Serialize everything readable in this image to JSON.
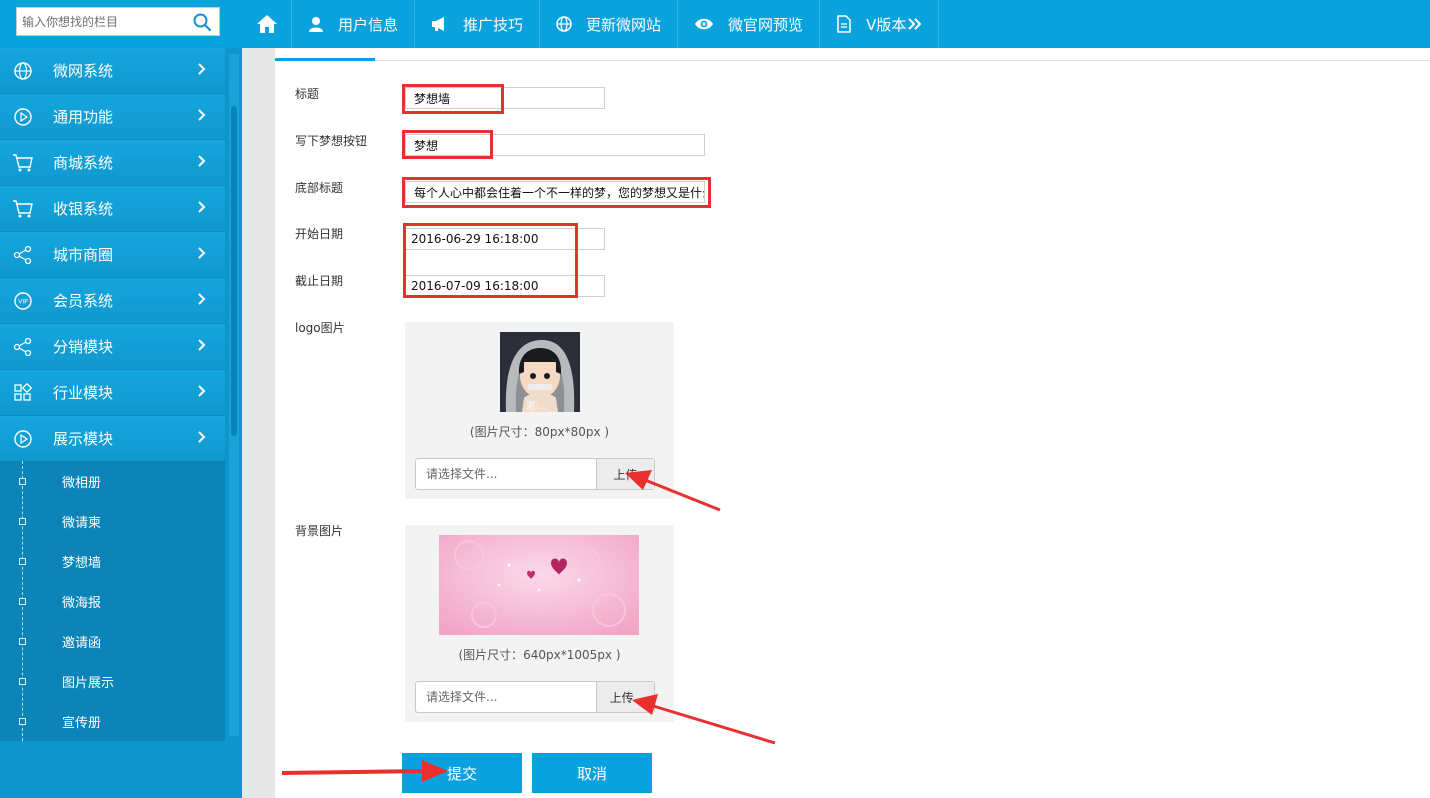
{
  "search": {
    "placeholder": "输入你想找的栏目"
  },
  "topnav": {
    "home_icon": "home-icon",
    "items": [
      {
        "label": "用户信息",
        "icon": "user-icon"
      },
      {
        "label": "推广技巧",
        "icon": "megaphone-icon"
      },
      {
        "label": "更新微网站",
        "icon": "globe-icon"
      },
      {
        "label": "微官网预览",
        "icon": "eye-icon"
      },
      {
        "label": "V版本",
        "icon": "document-icon"
      }
    ]
  },
  "sidebar": {
    "items": [
      {
        "label": "微网系统",
        "icon": "globe-icon"
      },
      {
        "label": "通用功能",
        "icon": "play-icon"
      },
      {
        "label": "商城系统",
        "icon": "cart-icon"
      },
      {
        "label": "收银系统",
        "icon": "cart-icon"
      },
      {
        "label": "城市商圈",
        "icon": "share-icon"
      },
      {
        "label": "会员系统",
        "icon": "vip-icon"
      },
      {
        "label": "分销模块",
        "icon": "share-icon"
      },
      {
        "label": "行业模块",
        "icon": "grid-icon"
      },
      {
        "label": "展示模块",
        "icon": "play-icon"
      }
    ],
    "submenu": [
      {
        "label": "微相册"
      },
      {
        "label": "微请柬"
      },
      {
        "label": "梦想墙"
      },
      {
        "label": "微海报"
      },
      {
        "label": "邀请函"
      },
      {
        "label": "图片展示"
      },
      {
        "label": "宣传册"
      }
    ]
  },
  "form": {
    "title_label": "标题",
    "title_value": "梦想墙",
    "button_label": "写下梦想按钮",
    "button_value": "梦想",
    "footer_label": "底部标题",
    "footer_value": "每个人心中都会住着一个不一样的梦，您的梦想又是什么",
    "start_label": "开始日期",
    "start_value": "2016-06-29 16:18:00",
    "end_label": "截止日期",
    "end_value": "2016-07-09 16:18:00",
    "logo_label": "logo图片",
    "logo_hint": "(图片尺寸：80px*80px )",
    "logo_file_placeholder": "请选择文件...",
    "logo_upload": "上传",
    "bg_label": "背景图片",
    "bg_hint": "(图片尺寸：640px*1005px )",
    "bg_file_placeholder": "请选择文件...",
    "bg_upload": "上传..",
    "submit": "提交",
    "cancel": "取消"
  },
  "colors": {
    "primary": "#0aa2dc",
    "sidebar": "#0e96cc",
    "submenu": "#0c84b8",
    "annotation": "#e8302f"
  }
}
